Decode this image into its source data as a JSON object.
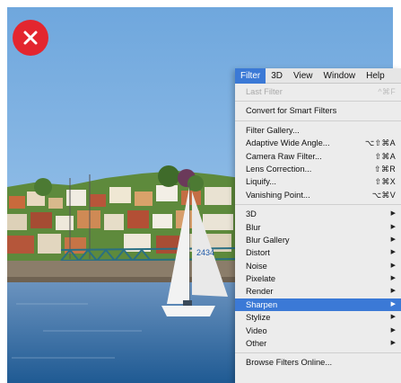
{
  "menubar": {
    "items": [
      {
        "label": "Filter"
      },
      {
        "label": "3D"
      },
      {
        "label": "View"
      },
      {
        "label": "Window"
      },
      {
        "label": "Help"
      }
    ]
  },
  "photo": {
    "sail_number": "2434"
  },
  "badge": {
    "icon": "close-icon",
    "color": "#e3262f"
  },
  "filter_menu": {
    "last_filter": {
      "label": "Last Filter",
      "shortcut": "^⌘F"
    },
    "convert": {
      "label": "Convert for Smart Filters"
    },
    "group1": [
      {
        "label": "Filter Gallery...",
        "shortcut": ""
      },
      {
        "label": "Adaptive Wide Angle...",
        "shortcut": "⌥⇧⌘A"
      },
      {
        "label": "Camera Raw Filter...",
        "shortcut": "⇧⌘A"
      },
      {
        "label": "Lens Correction...",
        "shortcut": "⇧⌘R"
      },
      {
        "label": "Liquify...",
        "shortcut": "⇧⌘X"
      },
      {
        "label": "Vanishing Point...",
        "shortcut": "⌥⌘V"
      }
    ],
    "group2": [
      {
        "label": "3D"
      },
      {
        "label": "Blur"
      },
      {
        "label": "Blur Gallery"
      },
      {
        "label": "Distort"
      },
      {
        "label": "Noise"
      },
      {
        "label": "Pixelate"
      },
      {
        "label": "Render"
      },
      {
        "label": "Sharpen"
      },
      {
        "label": "Stylize"
      },
      {
        "label": "Video"
      },
      {
        "label": "Other"
      }
    ],
    "highlighted": "Sharpen",
    "browse": {
      "label": "Browse Filters Online..."
    }
  },
  "colors": {
    "accent": "#3b79d6"
  }
}
